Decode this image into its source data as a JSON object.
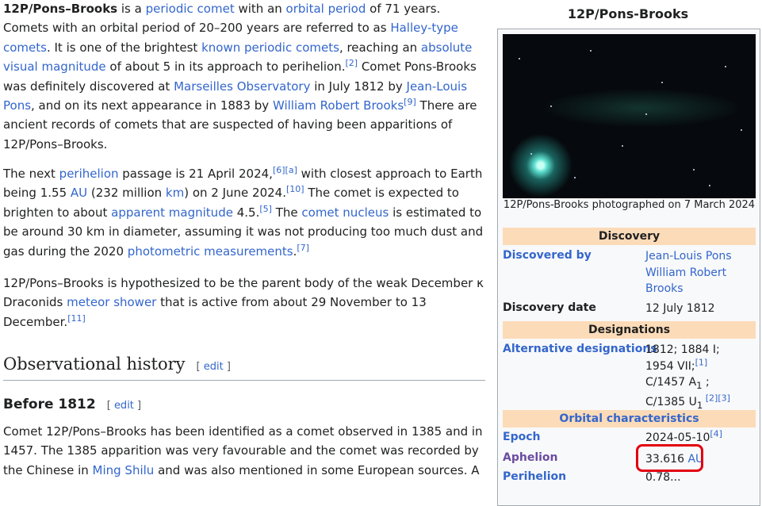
{
  "article": {
    "p1": {
      "t1": "12P/Pons–Brooks",
      "t2": " is a ",
      "l1": "periodic comet",
      "t3": " with an ",
      "l2": "orbital period",
      "t4": " of 71 years. Comets with an orbital period of 20–200 years are referred to as ",
      "l3": "Halley-type comets",
      "t5": ". It is one of the brightest ",
      "l4": "known periodic comets",
      "t6": ", reaching an ",
      "l5": "absolute visual magnitude",
      "t7": " of about 5 in its approach to perihelion.",
      "s1": "[2]",
      "t8": " Comet Pons-Brooks was definitely discovered at ",
      "l6": "Marseilles Observatory",
      "t9": " in July 1812 by ",
      "l7": "Jean-Louis Pons",
      "t10": ", and on its next appearance in 1883 by ",
      "l8": "William Robert Brooks",
      "s2": "[9]",
      "t11": " There are ancient records of comets that are suspected of having been apparitions of 12P/Pons–Brooks."
    },
    "p2": {
      "t1": "The next ",
      "l1": "perihelion",
      "t2": " passage is 21 April 2024,",
      "s1": "[6]",
      "s2": "[a]",
      "t3": " with closest approach to Earth being 1.55 ",
      "l2": "AU",
      "t4": " (232 million ",
      "l3": "km",
      "t5": ") on 2 June 2024.",
      "s3": "[10]",
      "t6": " The comet is expected to brighten to about ",
      "l4": "apparent magnitude",
      "t7": " 4.5.",
      "s4": "[5]",
      "t8": " The ",
      "l5": "comet nucleus",
      "t9": " is estimated to be around 30 km in diameter, assuming it was not producing too much dust and gas during the 2020 ",
      "l6": "photometric measurements",
      "t10": ".",
      "s5": "[7]"
    },
    "p3": {
      "t1": "12P/Pons–Brooks is hypothesized to be the parent body of the weak December κ Draconids ",
      "l1": "meteor shower",
      "t2": " that is active from about 29 November to 13 December.",
      "s1": "[11]"
    },
    "h2": "Observational history",
    "h3": "Before 1812",
    "edit_open": "[ ",
    "edit_label": "edit",
    "edit_close": " ]",
    "p4": {
      "t1": "Comet 12P/Pons–Brooks has been identified as a comet observed in 1385 and in 1457. The 1385 apparition was very favourable and the comet was recorded by the Chinese in ",
      "l1": "Ming Shilu",
      "t2": " and was also mentioned in some European sources. A"
    }
  },
  "infobox": {
    "title": "12P/Pons-Brooks",
    "caption": "12P/Pons-Brooks photographed on 7 March 2024",
    "discovery_header": "Discovery",
    "discovered_by_label": "Discovered by",
    "discoverer1": "Jean-Louis Pons",
    "discoverer2": "William Robert Brooks",
    "discovery_date_label": "Discovery date",
    "discovery_date": "12 July 1812",
    "designations_header": "Designations",
    "alt_designations_label": "Alternative designations",
    "alt1": "1812; 1884 I;",
    "alt2": "1954 VII;",
    "alt2_ref": "[1]",
    "alt3": "C/1457 A",
    "alt3_sub": "1",
    "alt3_tail": " ;",
    "alt4": "C/1385 U",
    "alt4_sub": "1",
    "alt4_ref": " [2][3]",
    "orbital_header": "Orbital characteristics",
    "epoch_label": "Epoch",
    "epoch": "2024-05-10",
    "epoch_ref": "[4]",
    "aphelion_label": "Aphelion",
    "aphelion_value": "33.616",
    "aphelion_unit": "AU",
    "perihelion_label": "Perihelion",
    "perihelion_value": "0.78..."
  },
  "colors": {
    "link": "#3366cc",
    "infobox_header": "#fcdbb8",
    "highlight": "#e3000f"
  }
}
